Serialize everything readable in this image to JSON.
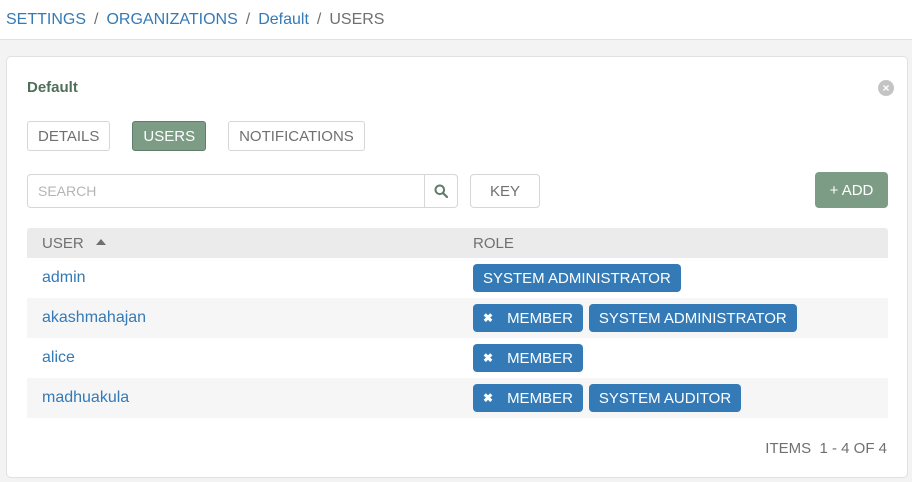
{
  "breadcrumb": {
    "items": [
      {
        "label": "SETTINGS",
        "current": false
      },
      {
        "label": "ORGANIZATIONS",
        "current": false
      },
      {
        "label": "Default",
        "current": false
      },
      {
        "label": "USERS",
        "current": true
      }
    ],
    "separator": "/"
  },
  "card": {
    "title": "Default",
    "close_icon": "close-circle-icon"
  },
  "tabs": [
    {
      "label": "DETAILS",
      "active": false
    },
    {
      "label": "USERS",
      "active": true
    },
    {
      "label": "NOTIFICATIONS",
      "active": false
    }
  ],
  "search": {
    "placeholder": "SEARCH",
    "value": "",
    "icon": "search-icon"
  },
  "key_button": {
    "label": "KEY"
  },
  "add_button": {
    "label": "+ ADD"
  },
  "table": {
    "columns": [
      {
        "label": "USER",
        "sorted": "ascending"
      },
      {
        "label": "ROLE"
      }
    ],
    "rows": [
      {
        "user": "admin",
        "roles": [
          {
            "label": "SYSTEM ADMINISTRATOR",
            "removable": false
          }
        ]
      },
      {
        "user": "akashmahajan",
        "roles": [
          {
            "label": "MEMBER",
            "removable": true
          },
          {
            "label": "SYSTEM ADMINISTRATOR",
            "removable": false
          }
        ]
      },
      {
        "user": "alice",
        "roles": [
          {
            "label": "MEMBER",
            "removable": true
          }
        ]
      },
      {
        "user": "madhuakula",
        "roles": [
          {
            "label": "MEMBER",
            "removable": true
          },
          {
            "label": "SYSTEM AUDITOR",
            "removable": false
          }
        ]
      }
    ]
  },
  "pagination": {
    "items_label": "ITEMS",
    "range": "1 - 4 OF 4"
  },
  "colors": {
    "link": "#337ab7",
    "accent_green": "#7c9c85",
    "badge_blue": "#337ab7",
    "title_green": "#4f6f58"
  }
}
